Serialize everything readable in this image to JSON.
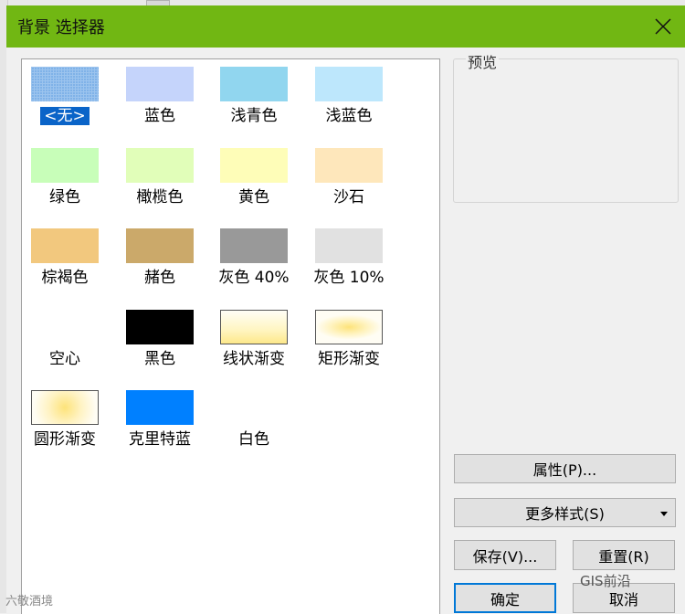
{
  "window": {
    "title": "背景 选择器"
  },
  "gallery": {
    "items": [
      {
        "label": "<无>",
        "selected": true
      },
      {
        "label": "蓝色"
      },
      {
        "label": "浅青色"
      },
      {
        "label": "浅蓝色"
      },
      {
        "label": "绿色"
      },
      {
        "label": "橄榄色"
      },
      {
        "label": "黄色"
      },
      {
        "label": "沙石"
      },
      {
        "label": "棕褐色"
      },
      {
        "label": "赭色"
      },
      {
        "label": "灰色 40%"
      },
      {
        "label": "灰色 10%"
      },
      {
        "label": "空心"
      },
      {
        "label": "黑色"
      },
      {
        "label": "线状渐变"
      },
      {
        "label": "矩形渐变"
      },
      {
        "label": "圆形渐变"
      },
      {
        "label": "克里特蓝"
      },
      {
        "label": "白色"
      }
    ],
    "colors": {
      "blue": "#c5d4fb",
      "light_cyan": "#91d6ef",
      "light_blue": "#bde7fc",
      "green": "#c8feb9",
      "olive": "#e1feb9",
      "yellow": "#fefdb8",
      "sand": "#fee7bb",
      "tan": "#f2c87e",
      "ochre": "#cba96a",
      "gray40": "#999999",
      "gray10": "#e1e1e1",
      "black": "#000000",
      "crete_blue": "#0080ff",
      "selected_highlight": "#0a64c8"
    }
  },
  "preview": {
    "title": "预览"
  },
  "buttons": {
    "properties": "属性(P)...",
    "more_styles": "更多样式(S)",
    "save": "保存(V)...",
    "reset": "重置(R)",
    "ok": "确定",
    "cancel": "取消"
  },
  "watermarks": {
    "left": "六敬酒境",
    "right": "GIS前沿"
  }
}
